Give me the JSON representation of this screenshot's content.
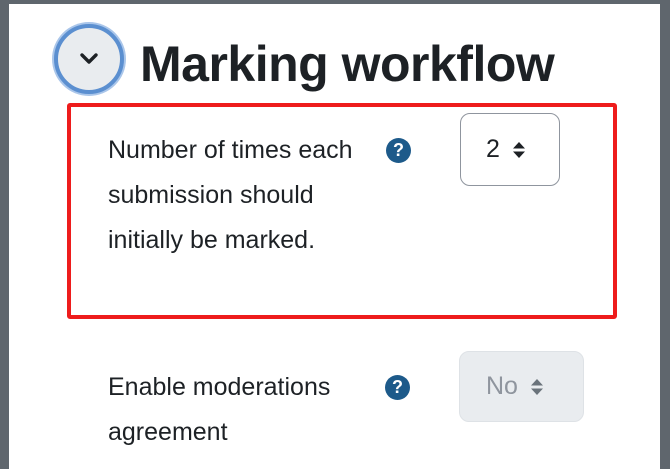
{
  "section": {
    "title": "Marking workflow",
    "toggle_icon": "chevron-down-icon"
  },
  "fields": [
    {
      "label": "Number of times each submission should initially be marked.",
      "help_icon": "question-circle-icon",
      "help_glyph": "?",
      "value": "2",
      "disabled": false,
      "highlighted": true
    },
    {
      "label": "Enable moderations agreement",
      "help_icon": "question-circle-icon",
      "help_glyph": "?",
      "value": "No",
      "disabled": true,
      "highlighted": false
    }
  ],
  "colors": {
    "highlight_border": "#ee1c1c",
    "help_icon": "#1d5a8a",
    "focus_ring": "#5b8fd0",
    "window_frame": "#5f666d"
  }
}
